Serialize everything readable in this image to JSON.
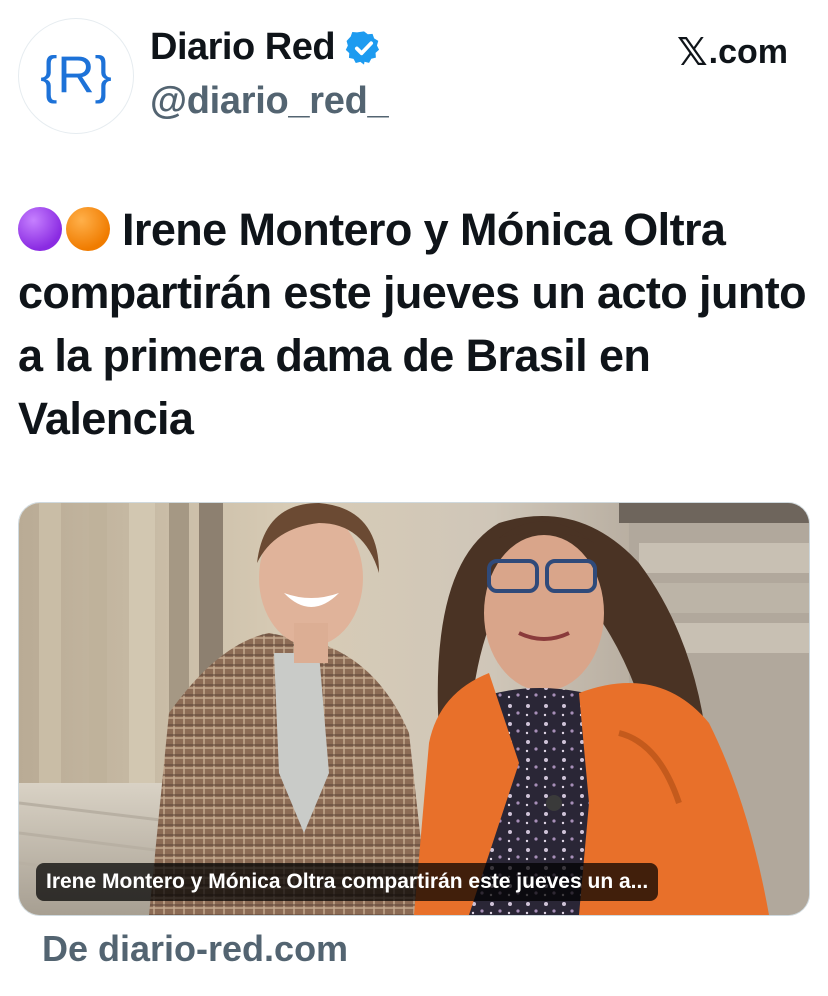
{
  "account": {
    "name": "Diario Red",
    "handle": "@diario_red_",
    "avatar_letter": "{R}",
    "verified": true
  },
  "platform": {
    "logo_text": ".com",
    "logo_icon": "x-logo-icon"
  },
  "tweet": {
    "emojis": [
      "purple-circle",
      "orange-circle"
    ],
    "text": "Irene Montero y Mónica Oltra compartirán este jueves un acto junto a la primera dama de Brasil en Valencia"
  },
  "link_card": {
    "caption": "Irene Montero y Mónica Oltra compartirán este jueves un a...",
    "source": "De diario-red.com"
  },
  "colors": {
    "brand_blue": "#1d72d8",
    "verified_blue": "#1d9bf0",
    "muted_text": "#536471",
    "coat_orange": "#e8702a"
  }
}
